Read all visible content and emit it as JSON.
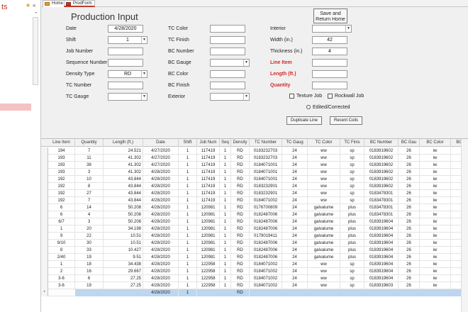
{
  "nav": {
    "title": "ts",
    "star_icon": "star-icon",
    "collapse_icon": "double-chevron-left-icon"
  },
  "tabs": [
    {
      "label": "Home"
    },
    {
      "label": "ProdForm"
    }
  ],
  "form": {
    "title": "Production Input",
    "save_button": "Save and Return Home",
    "save_line1": "Save and",
    "save_line2": "Return Home",
    "fields": {
      "date": {
        "label": "Date",
        "value": "4/28/2020"
      },
      "shift": {
        "label": "Shift",
        "value": "1"
      },
      "job_number": {
        "label": "Job Number",
        "value": ""
      },
      "sequence_number": {
        "label": "Sequence Number",
        "value": ""
      },
      "density_type": {
        "label": "Density Type",
        "value": "RD"
      },
      "tc_number": {
        "label": "TC Number",
        "value": ""
      },
      "tc_gauge": {
        "label": "TC Gauge",
        "value": ""
      },
      "tc_color": {
        "label": "TC Color",
        "value": ""
      },
      "tc_finish": {
        "label": "TC Finish",
        "value": ""
      },
      "bc_number": {
        "label": "BC Number",
        "value": ""
      },
      "bc_gauge": {
        "label": "BC Gauge",
        "value": ""
      },
      "bc_color": {
        "label": "BC Color",
        "value": ""
      },
      "bc_finish": {
        "label": "BC Finish",
        "value": ""
      },
      "exterior": {
        "label": "Exterior",
        "value": ""
      },
      "interior": {
        "label": "Interior",
        "value": ""
      },
      "width": {
        "label": "Width (in.)",
        "value": "42"
      },
      "thickness": {
        "label": "Thickness (in.)",
        "value": "4"
      },
      "line_item": {
        "label": "Line Item",
        "value": ""
      },
      "length": {
        "label": "Length (ft.)",
        "value": ""
      },
      "quantity": {
        "label": "Quantity",
        "value": ""
      }
    },
    "texture_job": "Texture Job",
    "rockwall_job": "Rockwall Job",
    "edited_corrected": "Edited/Corrected",
    "duplicate_line": "Duplicate Line",
    "recent_coils": "Recent Coils",
    "colors": {
      "required_label": "#d12a2a",
      "selection_row": "#bcd7ef"
    }
  },
  "grid": {
    "columns": [
      "Line Item",
      "Quantity",
      "Length (ft.)",
      "Date",
      "Shift",
      "Job Num",
      "Seq",
      "Density",
      "TC Number",
      "TC Gaug",
      "TC Color",
      "TC Finis",
      "BC Number",
      "BC Gau",
      "BC Color",
      "BC"
    ],
    "rows": [
      [
        "194",
        "7",
        "24.521",
        "4/27/2020",
        "1",
        "117419",
        "1",
        "RD",
        "0183232703",
        "24",
        "ww",
        "sp",
        "0183919602",
        "26",
        "iw"
      ],
      [
        "193",
        "11",
        "41.302",
        "4/27/2020",
        "1",
        "117419",
        "1",
        "RD",
        "0183232703",
        "24",
        "ww",
        "sp",
        "0183919602",
        "26",
        "iw"
      ],
      [
        "193",
        "38",
        "41.302",
        "4/27/2020",
        "1",
        "117419",
        "1",
        "RD",
        "0184071001",
        "24",
        "ww",
        "sp",
        "0183919602",
        "26",
        "iw"
      ],
      [
        "193",
        "3",
        "41.302",
        "4/28/2020",
        "1",
        "117419",
        "1",
        "RD",
        "0184071001",
        "24",
        "ww",
        "sp",
        "0183919602",
        "26",
        "iw"
      ],
      [
        "192",
        "10",
        "43.844",
        "4/28/2020",
        "1",
        "117419",
        "1",
        "RD",
        "0184071001",
        "24",
        "ww",
        "sp",
        "0183919602",
        "26",
        "iw"
      ],
      [
        "192",
        "8",
        "43.844",
        "4/28/2020",
        "1",
        "117419",
        "1",
        "RD",
        "0183232901",
        "24",
        "ww",
        "sp",
        "0183919602",
        "26",
        "iw"
      ],
      [
        "192",
        "27",
        "43.844",
        "4/28/2020",
        "1",
        "117419",
        "1",
        "RD",
        "0183232901",
        "24",
        "ww",
        "sp",
        "0183478301",
        "26",
        "iw"
      ],
      [
        "192",
        "7",
        "43.844",
        "4/28/2020",
        "1",
        "117419",
        "1",
        "RD",
        "0184071002",
        "24",
        "ww",
        "sp",
        "0183478301",
        "26",
        "iw"
      ],
      [
        "6",
        "14",
        "50.208",
        "4/28/2020",
        "1",
        "120981",
        "1",
        "RD",
        "0176700809",
        "24",
        "galvalume",
        "plus",
        "0183478301",
        "26",
        "iw"
      ],
      [
        "6",
        "4",
        "50.208",
        "4/28/2020",
        "1",
        "120981",
        "1",
        "RD",
        "0182487006",
        "24",
        "galvalume",
        "plus",
        "0183478301",
        "26",
        "iw"
      ],
      [
        "6/7",
        "3",
        "50.208",
        "4/28/2020",
        "1",
        "120981",
        "1",
        "RD",
        "0182487006",
        "24",
        "galvalume",
        "plus",
        "0183919604",
        "26",
        "iw"
      ],
      [
        "1",
        "20",
        "34.198",
        "4/28/2020",
        "1",
        "120981",
        "1",
        "RD",
        "0182487006",
        "24",
        "galvalume",
        "plus",
        "0183919604",
        "26",
        "iw"
      ],
      [
        "9",
        "22",
        "10.51",
        "4/28/2020",
        "1",
        "120981",
        "1",
        "RD",
        "0179019411",
        "24",
        "galvalume",
        "plus",
        "0183919604",
        "26",
        "iw"
      ],
      [
        "9/10",
        "30",
        "10.51",
        "4/28/2020",
        "1",
        "120981",
        "1",
        "RD",
        "0182487006",
        "24",
        "galvalume",
        "plus",
        "0183919604",
        "26",
        "iw"
      ],
      [
        "8",
        "33",
        "10.427",
        "4/28/2020",
        "1",
        "120981",
        "1",
        "RD",
        "0182487006",
        "24",
        "galvalume",
        "plus",
        "0183919604",
        "26",
        "iw"
      ],
      [
        "2/40",
        "19",
        "9.51",
        "4/28/2020",
        "1",
        "120981",
        "1",
        "RD",
        "0182487006",
        "24",
        "galvalume",
        "plus",
        "0183919604",
        "26",
        "iw"
      ],
      [
        "1",
        "18",
        "34.438",
        "4/28/2020",
        "1",
        "122958",
        "1",
        "RD",
        "0184071002",
        "24",
        "ww",
        "sp",
        "0183919604",
        "26",
        "iw"
      ],
      [
        "2",
        "16",
        "29.667",
        "4/28/2020",
        "1",
        "122958",
        "1",
        "RD",
        "0184071002",
        "24",
        "ww",
        "sp",
        "0183919604",
        "26",
        "iw"
      ],
      [
        "3-6",
        "6",
        "27.25",
        "4/28/2020",
        "1",
        "122958",
        "1",
        "RD",
        "0184071002",
        "24",
        "ww",
        "sp",
        "0183919604",
        "26",
        "iw"
      ],
      [
        "3-6",
        "19",
        "27.25",
        "4/28/2020",
        "1",
        "122958",
        "1",
        "RD",
        "0184071002",
        "24",
        "ww",
        "sp",
        "0183919603",
        "26",
        "iw"
      ]
    ],
    "new_row": {
      "marker": "*",
      "date": "4/28/2020",
      "shift": "1",
      "density": "RD"
    }
  }
}
